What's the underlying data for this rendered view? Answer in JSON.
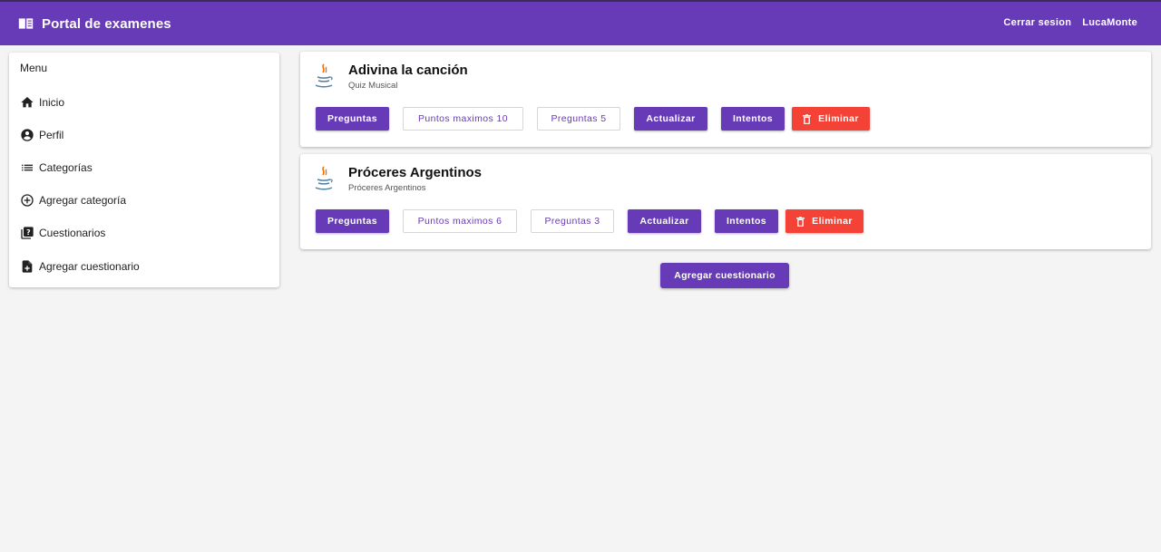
{
  "header": {
    "title": "Portal de examenes",
    "logout_label": "Cerrar sesion",
    "username": "LucaMonte"
  },
  "sidebar": {
    "title": "Menu",
    "items": [
      {
        "label": "Inicio",
        "icon": "home-icon"
      },
      {
        "label": "Perfil",
        "icon": "account-circle-icon"
      },
      {
        "label": "Categorías",
        "icon": "list-icon"
      },
      {
        "label": "Agregar categoría",
        "icon": "add-circle-icon"
      },
      {
        "label": "Cuestionarios",
        "icon": "quiz-icon"
      },
      {
        "label": "Agregar cuestionario",
        "icon": "note-add-icon"
      }
    ]
  },
  "quizzes": [
    {
      "title": "Adivina la canción",
      "category": "Quiz Musical",
      "questions_label": "Preguntas",
      "max_points_label": "Puntos maximos 10",
      "question_count_label": "Preguntas 5",
      "update_label": "Actualizar",
      "attempts_label": "Intentos",
      "delete_label": "Eliminar"
    },
    {
      "title": "Próceres Argentinos",
      "category": "Próceres Argentinos",
      "questions_label": "Preguntas",
      "max_points_label": "Puntos maximos 6",
      "question_count_label": "Preguntas 3",
      "update_label": "Actualizar",
      "attempts_label": "Intentos",
      "delete_label": "Eliminar"
    }
  ],
  "add_quiz_label": "Agregar cuestionario",
  "colors": {
    "primary": "#673ab7",
    "warn": "#f44336",
    "background": "#f4f4f4"
  }
}
